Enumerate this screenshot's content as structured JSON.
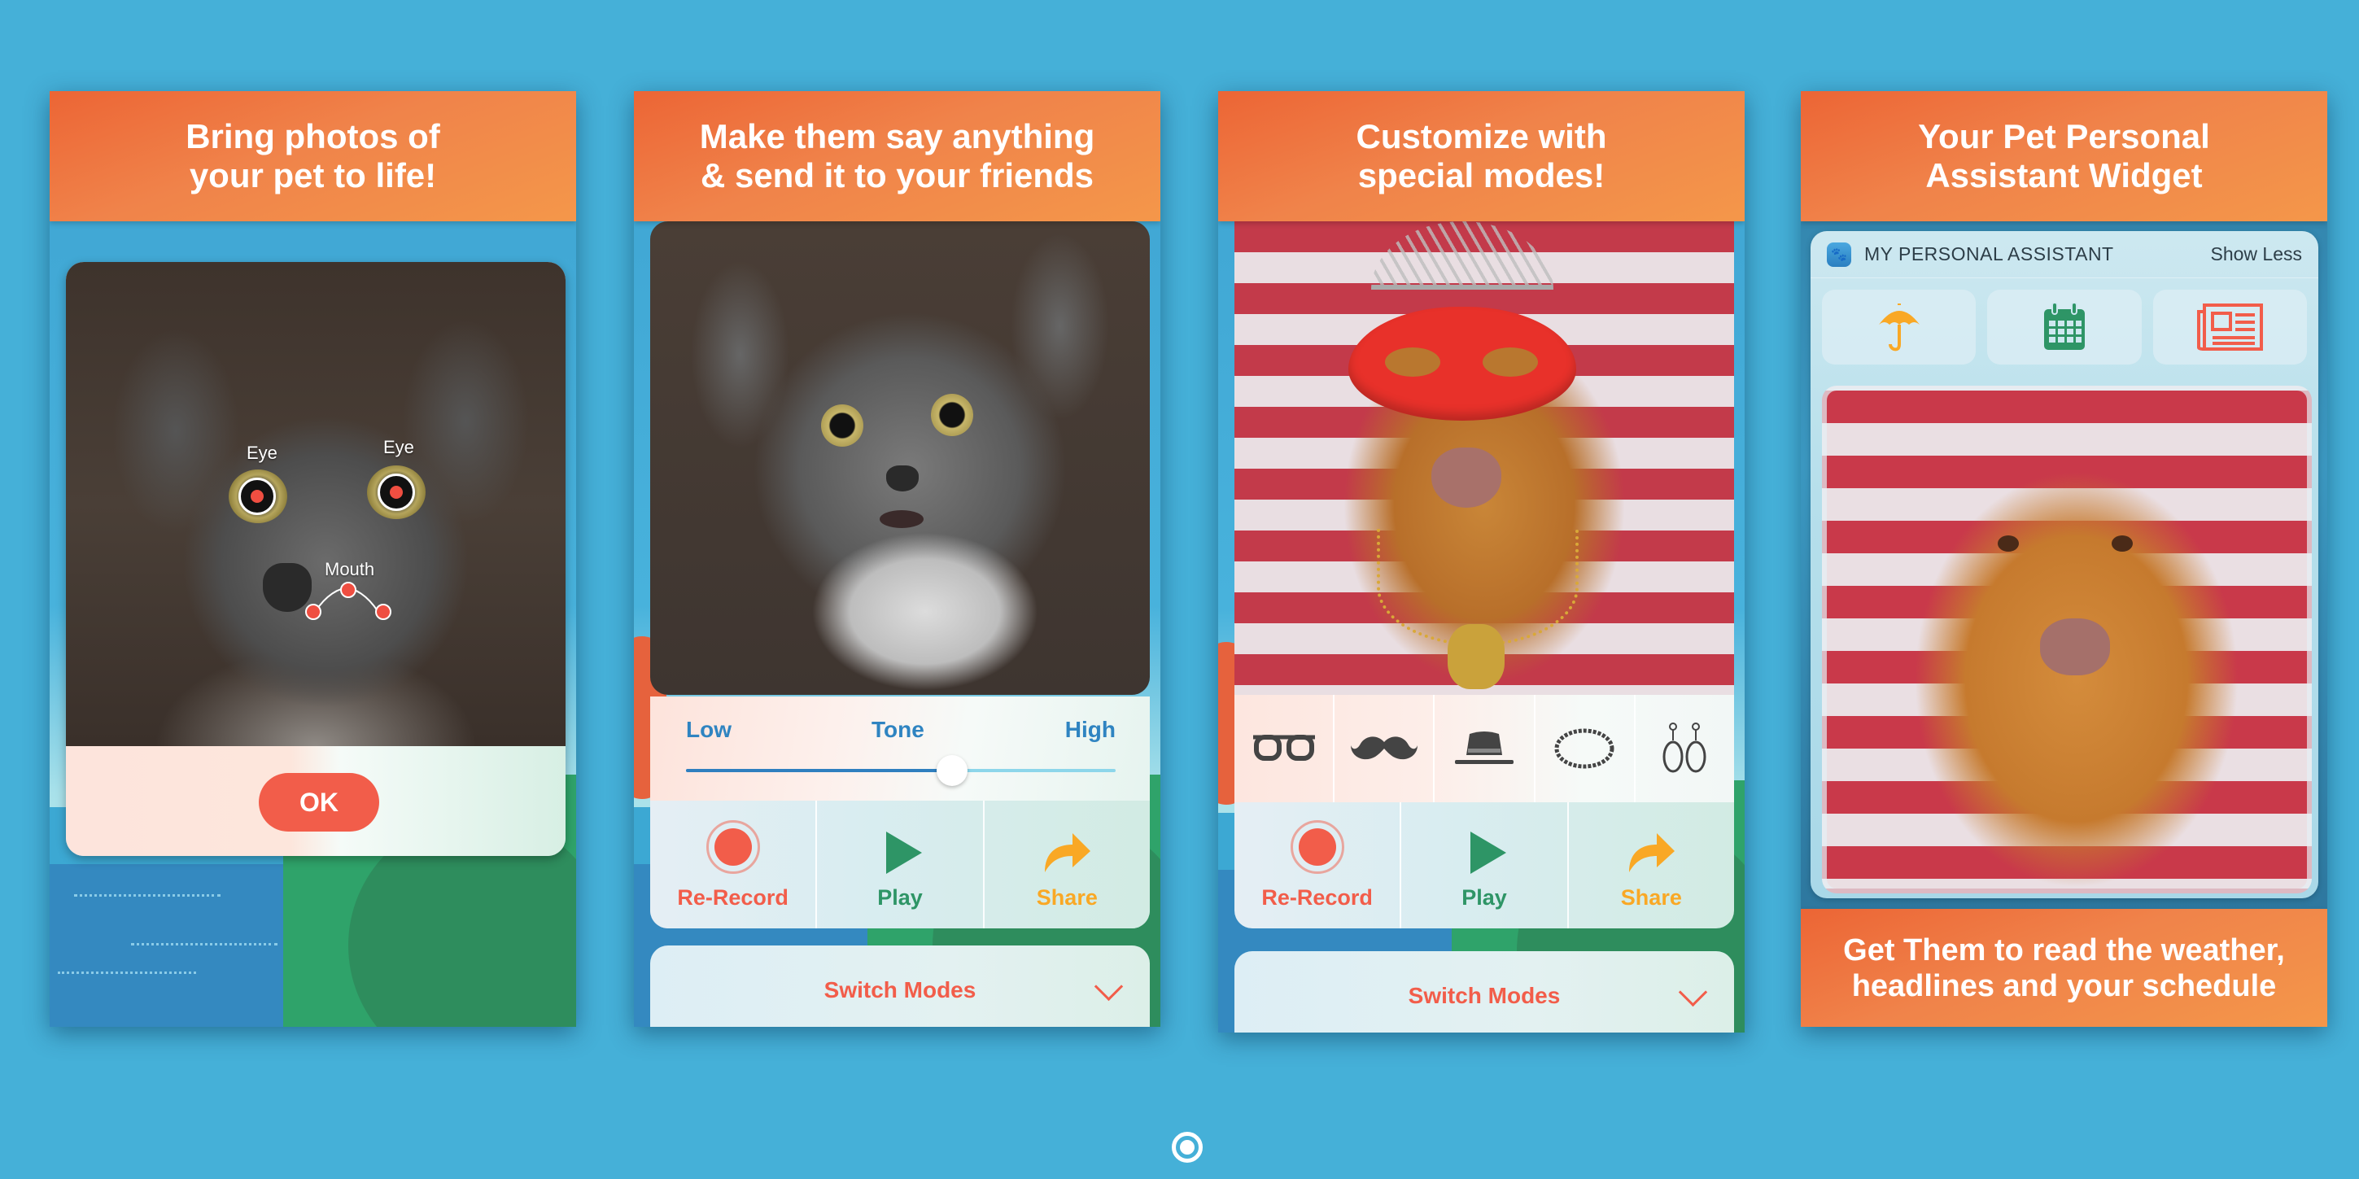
{
  "colors": {
    "background": "#45b0d8",
    "banner": "#ef7a44",
    "accent_red": "#f25d4a",
    "accent_green": "#2e9566",
    "accent_orange": "#f9a825",
    "accent_blue": "#2f84c1"
  },
  "panels": [
    {
      "banner_lines": [
        "Bring photos of",
        "your pet to life!"
      ],
      "markers": {
        "eye_left": "Eye",
        "eye_right": "Eye",
        "mouth": "Mouth"
      },
      "ok_label": "OK"
    },
    {
      "banner_lines": [
        "Make them say anything",
        "& send it to your friends"
      ],
      "tone": {
        "low_label": "Low",
        "title": "Tone",
        "high_label": "High",
        "value_fraction": 0.62
      },
      "actions": [
        {
          "label": "Re-Record",
          "icon": "record-icon"
        },
        {
          "label": "Play",
          "icon": "play-icon"
        },
        {
          "label": "Share",
          "icon": "share-icon"
        }
      ],
      "switch_modes_label": "Switch Modes"
    },
    {
      "banner_lines": [
        "Customize with",
        "special modes!"
      ],
      "accessories": [
        "glasses-icon",
        "mustache-icon",
        "hat-icon",
        "necklace-icon",
        "earrings-icon"
      ],
      "actions": [
        {
          "label": "Re-Record",
          "icon": "record-icon"
        },
        {
          "label": "Play",
          "icon": "play-icon"
        },
        {
          "label": "Share",
          "icon": "share-icon"
        }
      ],
      "switch_modes_label": "Switch Modes"
    },
    {
      "banner_lines": [
        "Your Pet Personal",
        "Assistant Widget"
      ],
      "widget": {
        "title": "MY PERSONAL ASSISTANT",
        "show_less": "Show Less",
        "tiles": [
          "umbrella-icon",
          "calendar-icon",
          "newspaper-icon"
        ]
      },
      "bottom_lines": [
        "Get Them to read the weather,",
        "headlines and your schedule"
      ]
    }
  ],
  "pager": {
    "current_page": 1,
    "total_pages": 1
  }
}
